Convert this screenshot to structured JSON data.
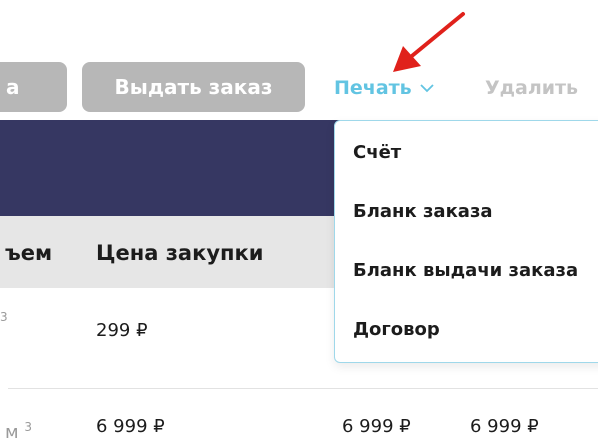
{
  "toolbar": {
    "partial_button_label": "а",
    "issue_order_label": "Выдать заказ",
    "print_label": "Печать",
    "delete_label": "Удалить"
  },
  "table": {
    "headers": {
      "volume": "ъем",
      "purchase_price": "Цена закупки"
    },
    "rows": [
      {
        "volume_unit": "",
        "volume_sup": "3",
        "purchase_price": "299 ₽"
      },
      {
        "volume_unit": "м",
        "volume_sup": "3",
        "purchase_price": "6 999 ₽",
        "price_3": "6 999 ₽",
        "price_4": "6 999 ₽"
      }
    ]
  },
  "print_menu": {
    "items": [
      "Счёт",
      "Бланк заказа",
      "Бланк выдачи заказа",
      "Договор"
    ]
  },
  "colors": {
    "accent": "#62c4e2",
    "header_dark": "#363762",
    "button_grey": "#b7b7b7",
    "arrow": "#e0211b"
  },
  "icons": {
    "print_chevron": "chevron-down-icon",
    "annotation_arrow": "red-arrow-icon"
  }
}
